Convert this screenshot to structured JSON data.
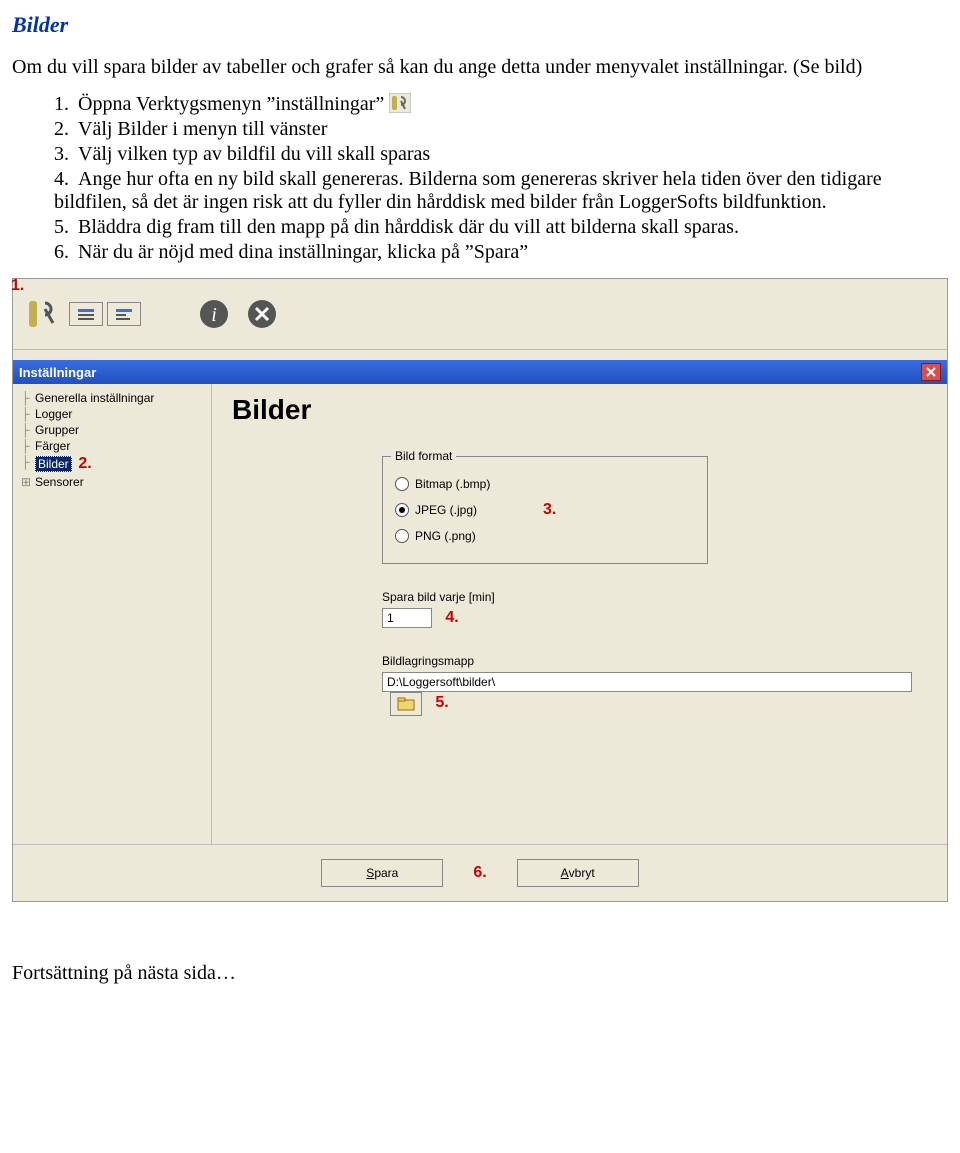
{
  "heading": "Bilder",
  "intro": "Om du vill spara bilder av tabeller och grafer så kan du ange detta under menyvalet inställningar. (Se bild)",
  "steps": {
    "s1": "Öppna Verktygsmenyn ”inställningar”",
    "s2": "Välj Bilder i menyn till vänster",
    "s3": "Välj vilken typ av bildfil du vill skall sparas",
    "s4": "Ange hur ofta en ny bild skall genereras. Bilderna som genereras skriver hela tiden över den tidigare bildfilen, så det är ingen risk att du fyller din hårddisk med bilder från LoggerSofts bildfunktion.",
    "s5": "Bläddra dig fram till den mapp på din hårddisk där du vill att bilderna skall sparas.",
    "s6": "När du är nöjd med dina inställningar, klicka på ”Spara”"
  },
  "callouts": {
    "c1": "1.",
    "c2": "2.",
    "c3": "3.",
    "c4": "4.",
    "c5": "5.",
    "c6": "6."
  },
  "window": {
    "title": "Inställningar",
    "tree": {
      "item0": "Generella inställningar",
      "item1": "Logger",
      "item2": "Grupper",
      "item3": "Färger",
      "item4": "Bilder",
      "item5": "Sensorer"
    },
    "panel_title": "Bilder",
    "group_legend": "Bild format",
    "radios": {
      "r0": "Bitmap (.bmp)",
      "r1": "JPEG (.jpg)",
      "r2": "PNG (.png)"
    },
    "interval_label": "Spara bild varje [min]",
    "interval_value": "1",
    "folder_label": "Bildlagringsmapp",
    "folder_value": "D:\\Loggersoft\\bilder\\",
    "save_btn_pre": "S",
    "save_btn_rest": "para",
    "cancel_btn_pre": "A",
    "cancel_btn_rest": "vbryt"
  },
  "footer": "Fortsättning på nästa sida…"
}
